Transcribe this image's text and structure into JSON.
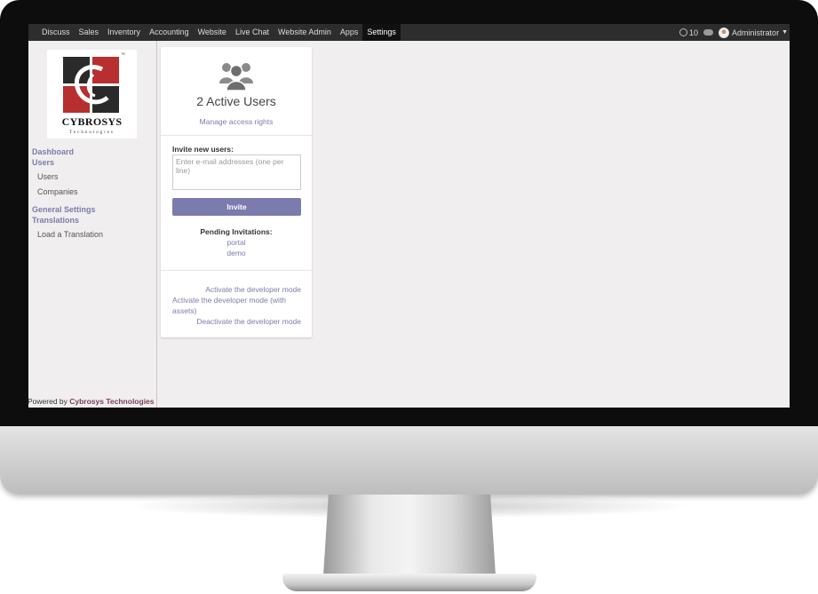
{
  "menu": {
    "items": [
      "Discuss",
      "Sales",
      "Inventory",
      "Accounting",
      "Website",
      "Live Chat",
      "Website Admin",
      "Apps",
      "Settings"
    ],
    "active": "Settings"
  },
  "topbar": {
    "notification_count": "10",
    "user_name": "Administrator",
    "icons": [
      "notification-icon",
      "chat-icon",
      "avatar",
      "caret-down-icon"
    ]
  },
  "logo": {
    "brand": "CYBROSYS",
    "subtitle": "Technologies",
    "trademark": "™",
    "colors": {
      "red": "#b82f2f",
      "dark": "#2a2a2a"
    }
  },
  "sidebar": {
    "sections": [
      {
        "label": "Dashboard"
      },
      {
        "label": "Users",
        "items": [
          "Users",
          "Companies"
        ]
      },
      {
        "label": "General Settings"
      },
      {
        "label": "Translations",
        "items": [
          "Load a Translation"
        ]
      }
    ],
    "footer_prefix": "Powered by ",
    "footer_brand": "Cybrosys Technologies"
  },
  "users_card": {
    "active_users": "2 Active Users",
    "manage_link": "Manage access rights",
    "invite_label": "Invite new users:",
    "email_placeholder": "Enter e-mail addresses (one per line)",
    "invite_button": "Invite",
    "pending_label": "Pending Invitations:",
    "pending": [
      "portal",
      "demo"
    ]
  },
  "developer": {
    "activate": "Activate the developer mode",
    "activate_assets": "Activate the developer mode (with assets)",
    "deactivate": "Deactivate the developer mode"
  },
  "colors": {
    "accent": "#7c7bad",
    "topbar": "#2d2d2d",
    "background": "#f0eeee"
  }
}
